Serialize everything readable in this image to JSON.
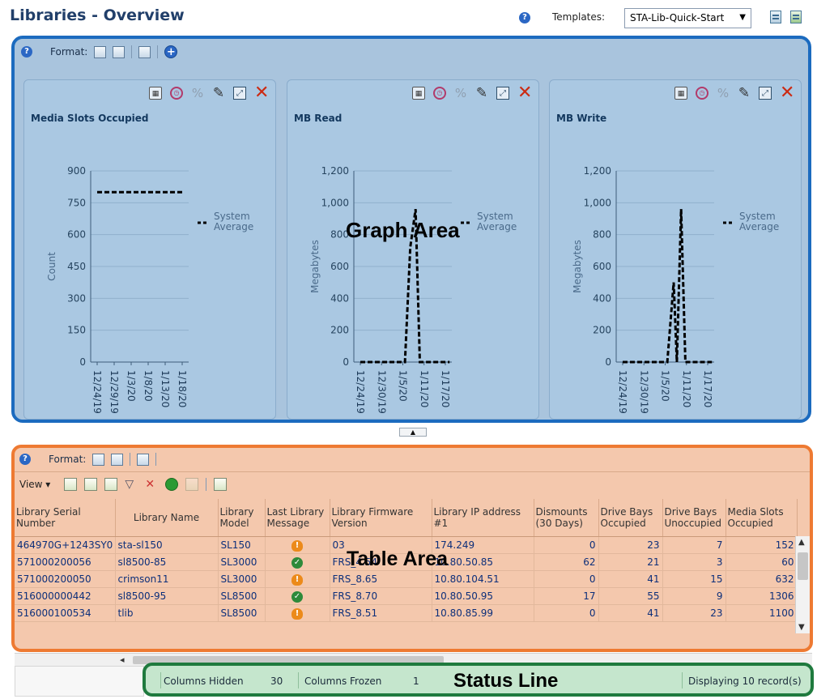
{
  "header": {
    "title": "Libraries - Overview",
    "templates_label": "Templates:",
    "template_selected": "STA-Lib-Quick-Start"
  },
  "graph_area": {
    "format_label": "Format:",
    "overlay_label": "Graph Area",
    "panels": [
      {
        "title": "Media Slots Occupied",
        "ylabel": "Count",
        "legend": "System Average",
        "chart_data": {
          "type": "line",
          "title": "Media Slots Occupied",
          "ylabel": "Count",
          "ylim": [
            0,
            900
          ],
          "yticks": [
            "0",
            "150",
            "300",
            "450",
            "600",
            "750",
            "900"
          ],
          "xticks": [
            "12/24/19",
            "12/29/19",
            "1/3/20",
            "1/8/20",
            "1/13/20",
            "1/18/20"
          ],
          "series": [
            {
              "name": "System Average",
              "x": [
                0,
                5
              ],
              "y": [
                800,
                800
              ]
            }
          ]
        }
      },
      {
        "title": "MB Read",
        "ylabel": "Megabytes",
        "legend": "System Average",
        "chart_data": {
          "type": "line",
          "title": "MB Read",
          "ylabel": "Megabytes",
          "ylim": [
            0,
            1200
          ],
          "yticks": [
            "0",
            "200",
            "400",
            "600",
            "800",
            "1,000",
            "1,200"
          ],
          "xticks": [
            "12/24/19",
            "12/30/19",
            "1/5/20",
            "1/11/20",
            "1/17/20"
          ],
          "series": [
            {
              "name": "System Average",
              "x": [
                0,
                2.1,
                2.35,
                2.6,
                2.8,
                3.0,
                4.2
              ],
              "y": [
                0,
                0,
                720,
                960,
                0,
                0,
                0
              ]
            }
          ]
        }
      },
      {
        "title": "MB Write",
        "ylabel": "Megabytes",
        "legend": "System Average",
        "chart_data": {
          "type": "line",
          "title": "MB Write",
          "ylabel": "Megabytes",
          "ylim": [
            0,
            1200
          ],
          "yticks": [
            "0",
            "200",
            "400",
            "600",
            "800",
            "1,000",
            "1,200"
          ],
          "xticks": [
            "12/24/19",
            "12/30/19",
            "1/5/20",
            "1/11/20",
            "1/17/20"
          ],
          "series": [
            {
              "name": "System Average",
              "x": [
                0,
                2.1,
                2.4,
                2.55,
                2.75,
                2.95,
                4.2
              ],
              "y": [
                0,
                0,
                500,
                0,
                960,
                0,
                0
              ]
            }
          ]
        }
      }
    ]
  },
  "table_area": {
    "format_label": "Format:",
    "view_label": "View",
    "overlay_label": "Table Area",
    "columns": [
      "Library Serial Number",
      "Library Name",
      "Library Model",
      "Last Library Message",
      "Library Firmware Version",
      "Library IP address #1",
      "Dismounts (30 Days)",
      "Drive Bays Occupied",
      "Drive Bays Unoccupied",
      "Media Slots Occupied"
    ],
    "rows": [
      {
        "serial": "464970G+1243SY0",
        "name": "sta-sl150",
        "model": "SL150",
        "msg": "warning",
        "fw": "03",
        "ip": "174.249",
        "dismounts": "0",
        "bays_occ": "23",
        "bays_unocc": "7",
        "slots": "152"
      },
      {
        "serial": "571000200056",
        "name": "sl8500-85",
        "model": "SL3000",
        "msg": "ok",
        "fw": "FRS_4.54",
        "ip": "10.80.50.85",
        "dismounts": "62",
        "bays_occ": "21",
        "bays_unocc": "3",
        "slots": "60"
      },
      {
        "serial": "571000200050",
        "name": "crimson11",
        "model": "SL3000",
        "msg": "warning",
        "fw": "FRS_8.65",
        "ip": "10.80.104.51",
        "dismounts": "0",
        "bays_occ": "41",
        "bays_unocc": "15",
        "slots": "632"
      },
      {
        "serial": "516000000442",
        "name": "sl8500-95",
        "model": "SL8500",
        "msg": "ok",
        "fw": "FRS_8.70",
        "ip": "10.80.50.95",
        "dismounts": "17",
        "bays_occ": "55",
        "bays_unocc": "9",
        "slots": "1306"
      },
      {
        "serial": "516000100534",
        "name": "tlib",
        "model": "SL8500",
        "msg": "warning",
        "fw": "FRS_8.51",
        "ip": "10.80.85.99",
        "dismounts": "0",
        "bays_occ": "41",
        "bays_unocc": "23",
        "slots": "1100"
      }
    ]
  },
  "status_line": {
    "columns_hidden_label": "Columns Hidden",
    "columns_hidden_value": "30",
    "columns_frozen_label": "Columns Frozen",
    "columns_frozen_value": "1",
    "overlay_label": "Status Line",
    "records_text": "Displaying 10 record(s)"
  },
  "colors": {
    "graph_area_border": "#1c6bbf",
    "table_area_border": "#ee7a32",
    "status_line_border": "#1f7a3e",
    "warning": "#ec8a1a",
    "ok": "#2e8a3a",
    "close": "#cc2a12"
  }
}
